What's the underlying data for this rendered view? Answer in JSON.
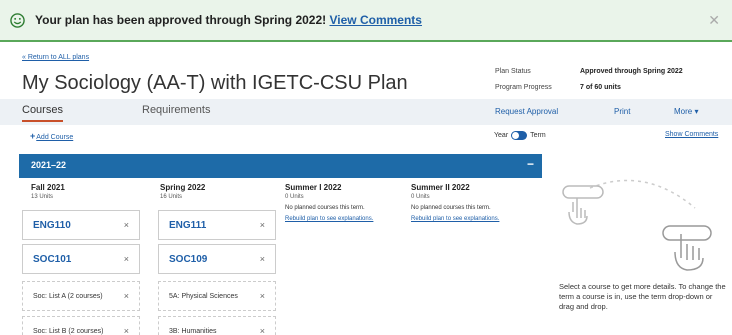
{
  "banner": {
    "message": "Your plan has been approved through Spring 2022!",
    "link": "View Comments",
    "close_glyph": "✕"
  },
  "nav": {
    "back_link": "« Return to ALL plans"
  },
  "page": {
    "title": "My Sociology (AA-T) with IGETC-CSU Plan"
  },
  "status": {
    "plan_status_label": "Plan Status",
    "plan_status_value": "Approved through Spring 2022",
    "progress_label": "Program Progress",
    "progress_value": "7 of 60 units"
  },
  "tabs": {
    "courses": "Courses",
    "requirements": "Requirements"
  },
  "actions": {
    "request_approval": "Request Approval",
    "print": "Print",
    "more": "More ▾"
  },
  "toolbar": {
    "add_course_plus": "+",
    "add_course": "Add Course",
    "year_label": "Year",
    "term_label": "Term",
    "show_comments": "Show Comments"
  },
  "year": {
    "label": "2021–22",
    "collapse_glyph": "−"
  },
  "terms": [
    {
      "name": "Fall 2021",
      "units": "13 Units"
    },
    {
      "name": "Spring 2022",
      "units": "16 Units"
    },
    {
      "name": "Summer I 2022",
      "units": "0 Units",
      "empty": "No planned courses this term.",
      "rebuild": "Rebuild plan to see explanations."
    },
    {
      "name": "Summer II 2022",
      "units": "0 Units",
      "empty": "No planned courses this term.",
      "rebuild": "Rebuild plan to see explanations."
    }
  ],
  "fall_items": [
    "ENG110",
    "SOC101",
    "Soc: List A (2 courses)",
    "Soc: List B (2 courses)"
  ],
  "spring_items": [
    "ENG111",
    "SOC109",
    "5A: Physical Sciences",
    "3B: Humanities"
  ],
  "remove_glyph": "×",
  "hint": "Select a course to get more details. To change the term a course is in, use the term drop-down or drag and drop.",
  "colors": {
    "accent": "#1f5fa8",
    "year_bar": "#1e6ba8",
    "banner_bg": "#eaf4ea",
    "banner_border": "#5aa85a",
    "tab_underline": "#c8502a"
  },
  "icons": [
    "smile-icon",
    "close-icon",
    "plus-icon",
    "toggle-switch",
    "drag-hand-icon",
    "tap-hand-icon"
  ]
}
